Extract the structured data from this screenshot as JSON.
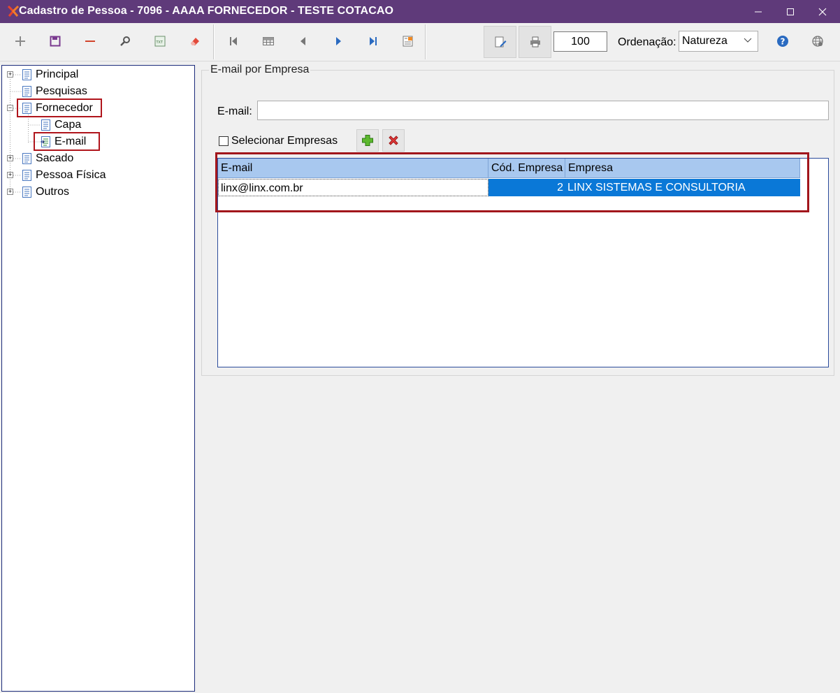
{
  "window": {
    "title": "Cadastro de Pessoa - 7096 - AAAA FORNECEDOR - TESTE COTACAO",
    "icon": "x-logo-icon",
    "controls": [
      "minimize-icon",
      "maximize-icon",
      "close-icon"
    ]
  },
  "toolbar": {
    "icons": [
      "plus-icon",
      "save-icon",
      "minus-icon",
      "search-icon",
      "txt-export-icon",
      "eraser-icon",
      "first-record-icon",
      "grid-icon",
      "previous-icon",
      "next-icon",
      "last-record-icon",
      "report-icon",
      "edit-doc-icon",
      "print-icon",
      "help-icon",
      "globe-icon"
    ],
    "zoom_value": "100",
    "ordering_label": "Ordenação:",
    "ordering_value": "Natureza"
  },
  "tree": {
    "items": [
      {
        "label": "Principal",
        "expander": "+"
      },
      {
        "label": "Pesquisas",
        "expander": ""
      },
      {
        "label": "Fornecedor",
        "expander": "−"
      },
      {
        "label": "Capa",
        "expander": ""
      },
      {
        "label": "E-mail",
        "expander": ""
      },
      {
        "label": "Sacado",
        "expander": "+"
      },
      {
        "label": "Pessoa Física",
        "expander": "+"
      },
      {
        "label": "Outros",
        "expander": "+"
      }
    ]
  },
  "panel": {
    "group_title": "E-mail por Empresa",
    "email_label": "E-mail:",
    "email_value": "",
    "select_companies_label": "Selecionar Empresas",
    "select_companies_checked": false
  },
  "grid": {
    "columns": [
      "E-mail",
      "Cód. Empresa",
      "Empresa"
    ],
    "rows": [
      {
        "email": "linx@linx.com.br",
        "cod_empresa": "2",
        "empresa": "LINX SISTEMAS E CONSULTORIA"
      }
    ]
  },
  "colors": {
    "titlebar": "#5f3a7a",
    "selection": "#0a78d7",
    "header": "#a8c8ef",
    "highlight": "#b0151c"
  }
}
